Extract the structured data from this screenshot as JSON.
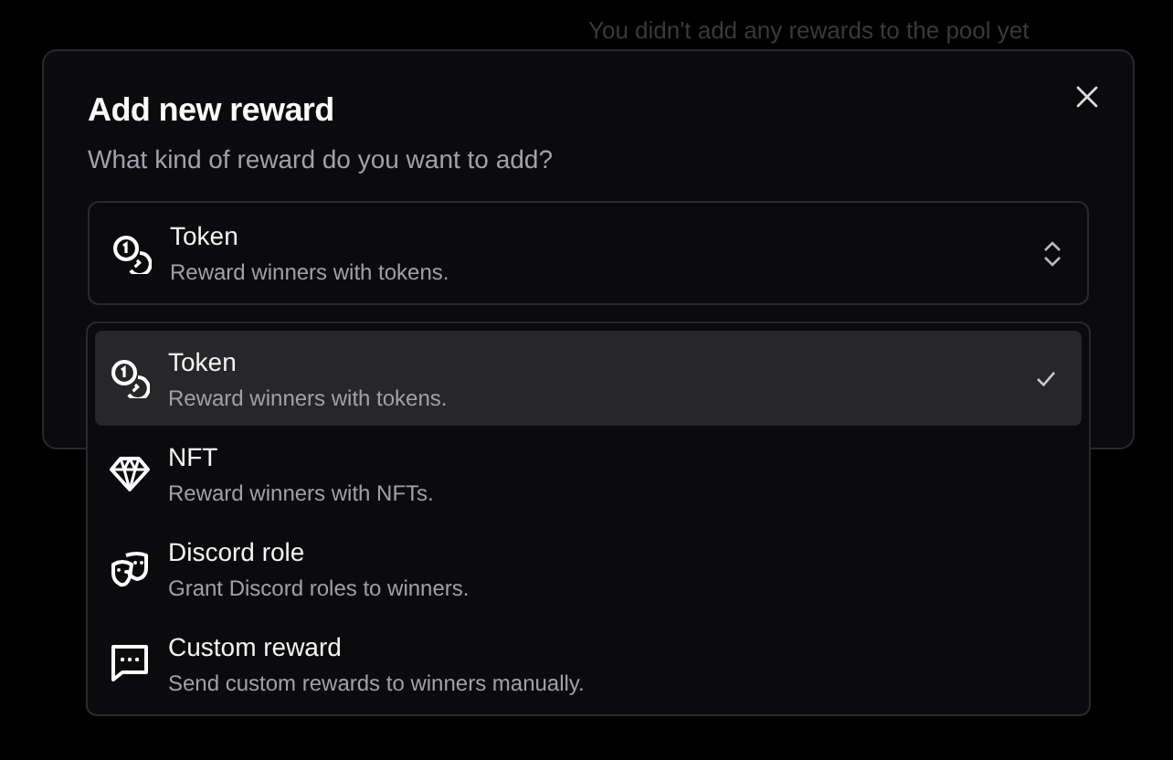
{
  "background": {
    "message": "You didn't add any rewards to the pool yet"
  },
  "dialog": {
    "title": "Add new reward",
    "subtitle": "What kind of reward do you want to add?",
    "select": {
      "kind": "token",
      "label": "Token",
      "description": "Reward winners with tokens.",
      "expanded": true
    },
    "options": [
      {
        "kind": "token",
        "label": "Token",
        "description": "Reward winners with tokens.",
        "selected": true
      },
      {
        "kind": "nft",
        "label": "NFT",
        "description": "Reward winners with NFTs.",
        "selected": false
      },
      {
        "kind": "role",
        "label": "Discord role",
        "description": "Grant Discord roles to winners.",
        "selected": false
      },
      {
        "kind": "custom",
        "label": "Custom reward",
        "description": "Send custom rewards to winners manually.",
        "selected": false
      }
    ]
  }
}
